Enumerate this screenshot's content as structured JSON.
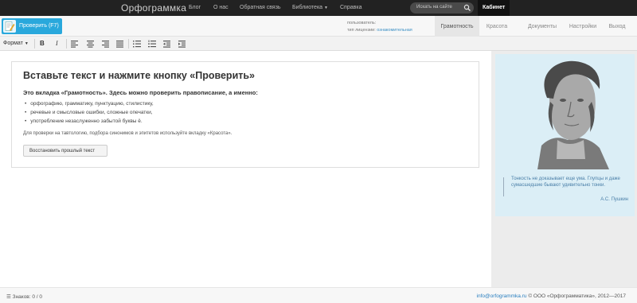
{
  "topbar": {
    "brand": "Орфограммка",
    "nav": [
      "Блог",
      "О нас",
      "Обратная связь",
      "Библиотека",
      "Справка"
    ],
    "search_placeholder": "Искать на сайте",
    "cabinet_label": "Кабинет"
  },
  "subbar": {
    "check_label": "Проверить (F7)",
    "user_label": "пользователь:",
    "license_label": "тип лицензии:",
    "license_value": "ознакомительная",
    "tabs": [
      "Грамотность",
      "Красота",
      "Документы",
      "Настройки",
      "Выход"
    ],
    "active_tab": "Грамотность"
  },
  "toolbar": {
    "format_label": "Формат",
    "bold_label": "B",
    "italic_label": "I"
  },
  "main": {
    "title": "Вставьте текст и нажмите кнопку «Проверить»",
    "subtitle": "Это вкладка «Грамотность». Здесь можно проверить правописание, а именно:",
    "bullets": [
      "орфографию, грамматику, пунктуацию, стилистику,",
      "речевые и смысловые ошибки, сложные опечатки,",
      "употребление незаслуженно забытой буквы ё."
    ],
    "note": "Для проверки на тавтологию, подбора синонимов и эпитетов используйте вкладку «Красота».",
    "restore_label": "Восстановить прошлый текст"
  },
  "quote": {
    "text": "Тонкость не доказывает еще ума. Глупцы и даже сумасшедшие бывают удивительно тонки.",
    "author": "А.С. Пушкин"
  },
  "footer": {
    "count": "Знаков: 0 / 0",
    "email": "info@orfogrammka.ru",
    "copyright": "© ООО «Орфограмматика», 2012—2017"
  },
  "colors": {
    "topbar_bg": "#222222",
    "accent": "#29a8dc",
    "quote_bg": "#dbeef6",
    "link": "#2a7fbf"
  }
}
